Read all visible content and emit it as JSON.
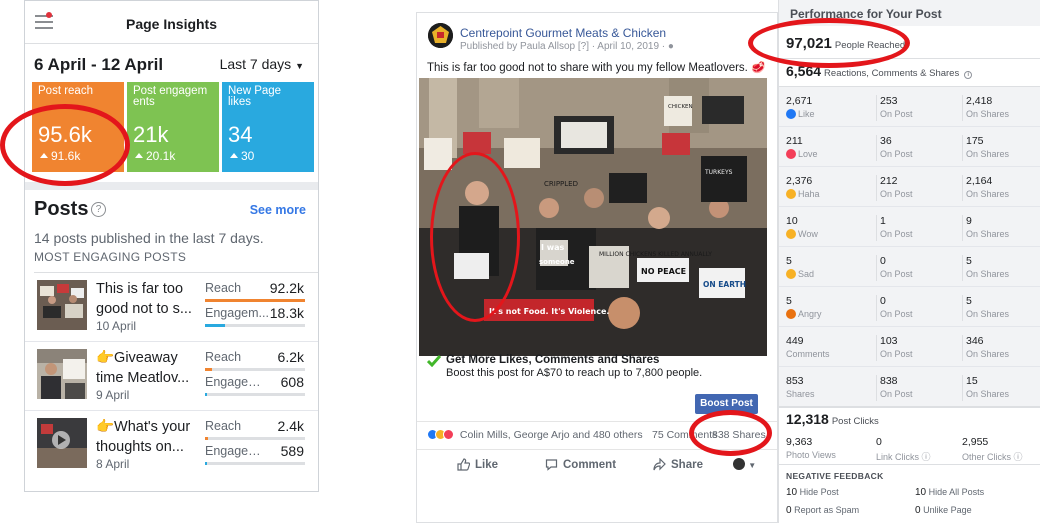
{
  "insights": {
    "title": "Page Insights",
    "date_range": "6 April - 12 April",
    "period": "Last 7 days",
    "tiles": [
      {
        "label": "Post reach",
        "value": "95.6k",
        "prev": "91.6k",
        "color": "#f08430"
      },
      {
        "label": "Post engagements",
        "value": "21k",
        "prev": "20.1k",
        "color": "#7ec352"
      },
      {
        "label": "New Page likes",
        "value": "34",
        "prev": "30",
        "color": "#29a9df"
      }
    ],
    "posts_heading": "Posts",
    "see_more": "See more",
    "posts_subtitle": "14 posts published in the last 7 days.",
    "most_engaging": "MOST ENGAGING POSTS",
    "posts": [
      {
        "title_line1": "This is far too",
        "title_line2": "good not to s...",
        "date": "10 April",
        "reach_label": "Reach",
        "reach": "92.2k",
        "eng_label": "Engagem...",
        "eng": "18.3k",
        "reach_fill": 1.0,
        "eng_fill": 0.2
      },
      {
        "title_line1": "👉Giveaway",
        "title_line2": "time Meatlov...",
        "date": "9 April",
        "reach_label": "Reach",
        "reach": "6.2k",
        "eng_label": "Engageme...",
        "eng": "608",
        "reach_fill": 0.07,
        "eng_fill": 0.02
      },
      {
        "title_line1": "👉What's your",
        "title_line2": "thoughts on...",
        "date": "8 April",
        "reach_label": "Reach",
        "reach": "2.4k",
        "eng_label": "Engageme...",
        "eng": "589",
        "reach_fill": 0.03,
        "eng_fill": 0.02
      }
    ]
  },
  "post": {
    "page_name": "Centrepoint Gourmet Meats & Chicken",
    "meta": "Published by Paula Allsop [?] · April 10, 2019 ·",
    "text": "This is far too good not to share with you my fellow Meatlovers. 🥩",
    "signs": [
      "I was someone who wanted to live.",
      "It's not Food. It's Violence.",
      "NO PEACE",
      "ON EARTH",
      "CRIPPLED",
      "MILLION CHICKENS KILLED ANNUALLY",
      "TURKEYS",
      "CHICKEN"
    ],
    "boost_heading": "Get More Likes, Comments and Shares",
    "boost_sub": "Boost this post for A$70 to reach up to 7,800 people.",
    "boost_button": "Boost Post",
    "reactors": "Colin Mills, George Arjo and 480 others",
    "comments": "75 Comments",
    "shares": "838 Shares",
    "actions": {
      "like": "Like",
      "comment": "Comment",
      "share": "Share"
    }
  },
  "performance": {
    "title": "Performance for Your Post",
    "people_reached": "97,021",
    "people_reached_label": "People Reached",
    "reactions_total": "6,564",
    "reactions_label": "Reactions, Comments & Shares",
    "rows": [
      {
        "total": "2,671",
        "label": "Like",
        "on_post": "253",
        "on_post_label": "On Post",
        "on_shares": "2,418",
        "on_shares_label": "On Shares",
        "icon": "like-icon",
        "icon_color": "#2078f4"
      },
      {
        "total": "211",
        "label": "Love",
        "on_post": "36",
        "on_post_label": "On Post",
        "on_shares": "175",
        "on_shares_label": "On Shares",
        "icon": "love-icon",
        "icon_color": "#f33e58"
      },
      {
        "total": "2,376",
        "label": "Haha",
        "on_post": "212",
        "on_post_label": "On Post",
        "on_shares": "2,164",
        "on_shares_label": "On Shares",
        "icon": "haha-icon",
        "icon_color": "#f7b125"
      },
      {
        "total": "10",
        "label": "Wow",
        "on_post": "1",
        "on_post_label": "On Post",
        "on_shares": "9",
        "on_shares_label": "On Shares",
        "icon": "wow-icon",
        "icon_color": "#f7b125"
      },
      {
        "total": "5",
        "label": "Sad",
        "on_post": "0",
        "on_post_label": "On Post",
        "on_shares": "5",
        "on_shares_label": "On Shares",
        "icon": "sad-icon",
        "icon_color": "#f7b125"
      },
      {
        "total": "5",
        "label": "Angry",
        "on_post": "0",
        "on_post_label": "On Post",
        "on_shares": "5",
        "on_shares_label": "On Shares",
        "icon": "angry-icon",
        "icon_color": "#e9710f"
      },
      {
        "total": "449",
        "label": "Comments",
        "on_post": "103",
        "on_post_label": "On Post",
        "on_shares": "346",
        "on_shares_label": "On Shares",
        "icon": "",
        "icon_color": ""
      },
      {
        "total": "853",
        "label": "Shares",
        "on_post": "838",
        "on_post_label": "On Post",
        "on_shares": "15",
        "on_shares_label": "On Shares",
        "icon": "",
        "icon_color": ""
      }
    ],
    "post_clicks": "12,318",
    "post_clicks_label": "Post Clicks",
    "clicks": [
      {
        "value": "9,363",
        "label": "Photo Views"
      },
      {
        "value": "0",
        "label": "Link Clicks"
      },
      {
        "value": "2,955",
        "label": "Other Clicks"
      }
    ],
    "negative_heading": "NEGATIVE FEEDBACK",
    "negative": [
      {
        "value": "10",
        "label": "Hide Post"
      },
      {
        "value": "10",
        "label": "Hide All Posts"
      },
      {
        "value": "0",
        "label": "Report as Spam"
      },
      {
        "value": "0",
        "label": "Unlike Page"
      }
    ]
  }
}
